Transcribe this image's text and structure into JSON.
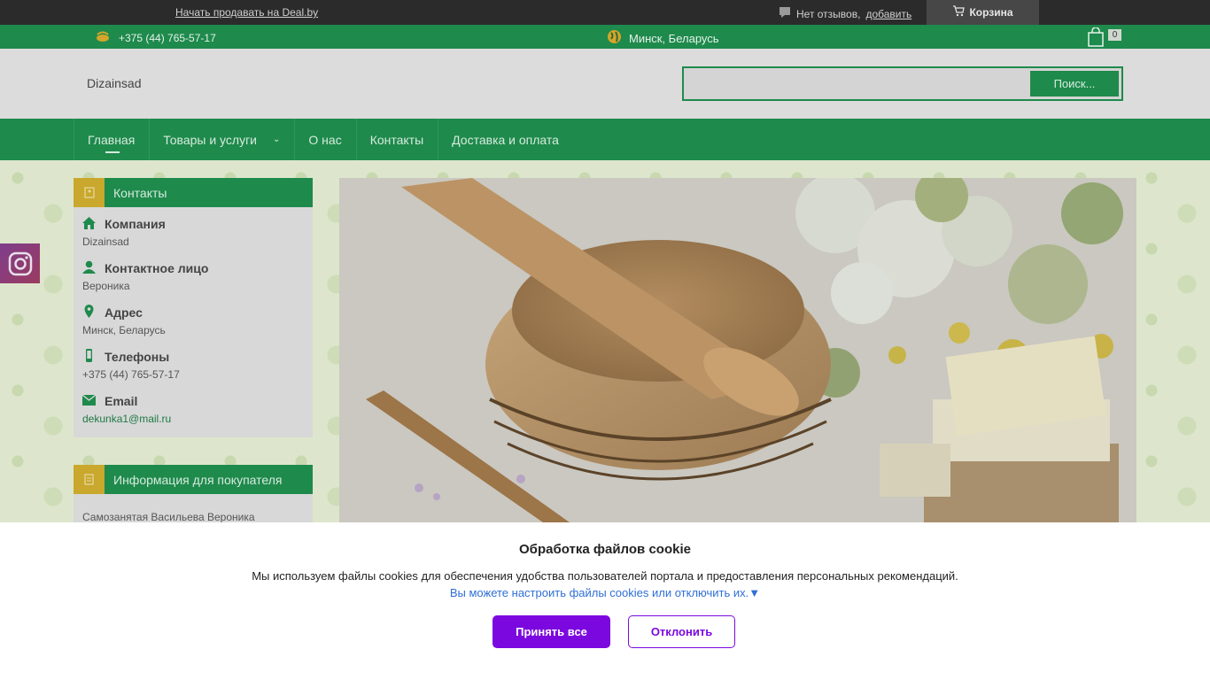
{
  "topbar": {
    "sell_link": "Начать продавать на Deal.by",
    "reviews_text": "Нет отзывов,",
    "reviews_add": "добавить",
    "cart_label": "Корзина"
  },
  "infobar": {
    "phone": "+375 (44) 765-57-17",
    "city": "Минск, Беларусь",
    "cart_count": "0"
  },
  "header": {
    "logo": "Dizainsad",
    "search_placeholder": "",
    "search_button": "Поиск..."
  },
  "nav": {
    "items": [
      {
        "label": "Главная"
      },
      {
        "label": "Товары и услуги"
      },
      {
        "label": "О нас"
      },
      {
        "label": "Контакты"
      },
      {
        "label": "Доставка и оплата"
      }
    ]
  },
  "contacts": {
    "title": "Контакты",
    "items": [
      {
        "label": "Компания",
        "value": "Dizainsad"
      },
      {
        "label": "Контактное лицо",
        "value": "Вероника"
      },
      {
        "label": "Адрес",
        "value": "Минск, Беларусь"
      },
      {
        "label": "Телефоны",
        "value": "+375 (44) 765-57-17"
      },
      {
        "label": "Email",
        "value": "dekunka1@mail.ru"
      }
    ]
  },
  "buyer_info": {
    "title": "Информация для покупателя",
    "text": "Самозанятая Васильева Вероника"
  },
  "cookie": {
    "title": "Обработка файлов cookie",
    "description": "Мы используем файлы cookies для обеспечения удобства пользователей портала и предоставления персональных рекомендаций.",
    "settings_link": "Вы можете настроить файлы cookies или отключить их.▼",
    "accept": "Принять все",
    "reject": "Отклонить"
  },
  "colors": {
    "green": "#1e8a4c",
    "gold": "#c9a82d",
    "purple": "#7c08e0"
  }
}
